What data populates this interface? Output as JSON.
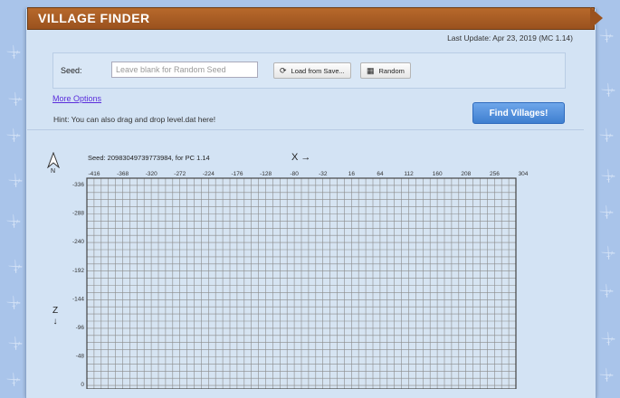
{
  "app": {
    "title": "VILLAGE FINDER",
    "last_update": "Last Update: Apr 23, 2019 (MC 1.14)"
  },
  "form": {
    "seed_label": "Seed:",
    "seed_placeholder": "Leave blank for Random Seed",
    "seed_value": "",
    "load_label": "Load from Save...",
    "random_label": "Random",
    "more_options": "More Options",
    "hint": "Hint: You can also drag and drop level.dat here!",
    "find_label": "Find Villages!"
  },
  "map": {
    "seed_info": "Seed: 20983049739773984, for PC 1.14",
    "north_label": "N",
    "x_label": "X →",
    "z_label": "Z",
    "z_arrow": "↓",
    "x_ticks": [
      "-416",
      "-368",
      "-320",
      "-272",
      "-224",
      "-176",
      "-128",
      "-80",
      "-32",
      "16",
      "64",
      "112",
      "160",
      "208",
      "256",
      "304"
    ],
    "z_ticks": [
      "-336",
      "-288",
      "-240",
      "-192",
      "-144",
      "-96",
      "-48",
      "0"
    ]
  },
  "icons": {
    "load": "rotate-icon",
    "random": "die-icon",
    "north": "north-arrow-icon"
  },
  "colors": {
    "banner": "#9a521e",
    "find_button": "#4a8ad8",
    "grid": "#8a8a8a",
    "panel": "#d3e3f4"
  }
}
